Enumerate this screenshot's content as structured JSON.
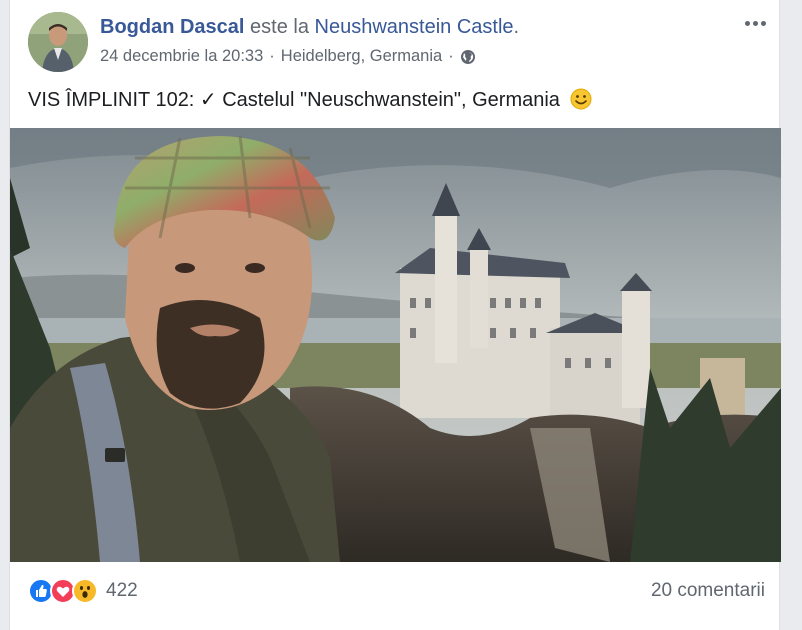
{
  "post": {
    "author": "Bogdan Dascal",
    "verb": "este la",
    "place": "Neushwanstein Castle",
    "punct": ".",
    "date": "24 decembrie la 20:33",
    "separator": "·",
    "location": "Heidelberg, Germania",
    "text": "VIS ÎMPLINIT 102: ✓ Castelul \"Neuschwanstein\", Germania",
    "icons": {
      "privacy": "globe-icon",
      "options": "more-options-icon",
      "emoji": "smiley-emoji"
    }
  },
  "footer": {
    "reactions": [
      {
        "name": "like-reaction-icon",
        "color": "#1877f2"
      },
      {
        "name": "love-reaction-icon",
        "color": "#f33e58"
      },
      {
        "name": "wow-reaction-icon",
        "color": "#f7b928"
      }
    ],
    "reaction_count": "422",
    "comments": "20 comentarii"
  },
  "colors": {
    "link": "#385898",
    "secondary": "#606770",
    "text": "#1c1e21",
    "background": "#e9ebee"
  }
}
